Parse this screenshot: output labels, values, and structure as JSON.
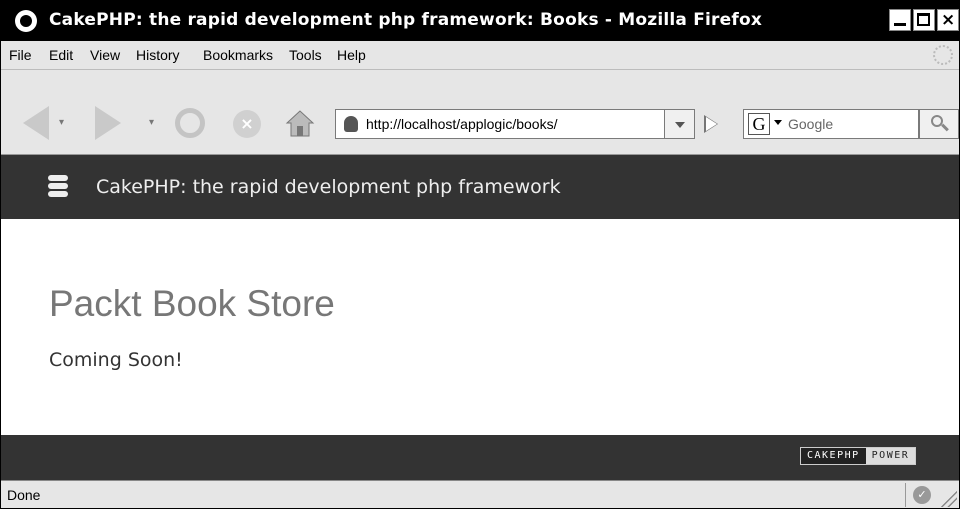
{
  "window": {
    "title": "CakePHP: the rapid development php framework: Books - Mozilla Firefox",
    "close_glyph": "×"
  },
  "menu": {
    "items": [
      "File",
      "Edit",
      "View",
      "History",
      "Bookmarks",
      "Tools",
      "Help"
    ]
  },
  "toolbar": {
    "url": "http://localhost/applogic/books/",
    "search_placeholder": "Google",
    "search_engine_glyph": "G",
    "stop_glyph": "×",
    "dropdown_glyph": "▾"
  },
  "page": {
    "header_title": "CakePHP: the rapid development php framework",
    "heading": "Packt Book Store",
    "message": "Coming Soon!",
    "power_badge_left": "CAKEPHP",
    "power_badge_right": "POWER"
  },
  "status": {
    "text": "Done",
    "check_glyph": "✓"
  }
}
